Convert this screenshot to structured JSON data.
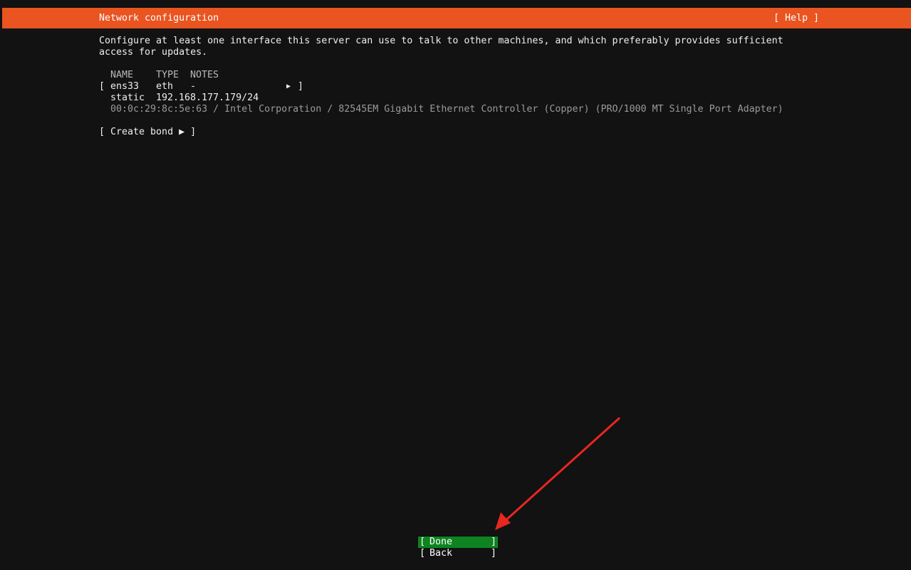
{
  "header": {
    "title": "Network configuration",
    "help_label": "[ Help ]"
  },
  "description": {
    "line1": "Configure at least one interface this server can use to talk to other machines, and which preferably provides sufficient",
    "line2": "access for updates."
  },
  "interfaces_table": {
    "columns": [
      "NAME",
      "TYPE",
      "NOTES"
    ],
    "rows": [
      {
        "open_bracket": "[",
        "name": "ens33",
        "type": "eth",
        "notes": "-",
        "expand_glyph": "▶",
        "close_bracket": "]",
        "address_method": "static",
        "address": "192.168.177.179/24",
        "hardware_info": "00:0c:29:8c:5e:63 / Intel Corporation / 82545EM Gigabit Ethernet Controller (Copper) (PRO/1000 MT Single Port Adapter)"
      }
    ]
  },
  "create_bond": {
    "label": "[ Create bond ▶ ]"
  },
  "buttons": {
    "done": {
      "left_bracket": "[",
      "label": "Done",
      "right_bracket": "]"
    },
    "back": {
      "left_bracket": "[",
      "label": "Back",
      "right_bracket": "]"
    }
  },
  "colors": {
    "background": "#121212",
    "header_orange": "#e95420",
    "focus_green": "#0e8420",
    "annotation_red": "#e8271f"
  }
}
